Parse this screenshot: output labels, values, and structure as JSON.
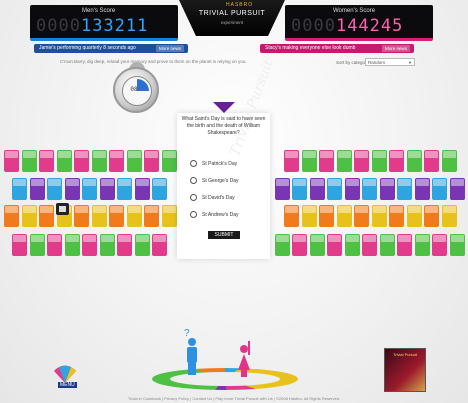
{
  "header": {
    "men_score_label": "Men's Score",
    "men_score_prefix": "0000",
    "men_score_value": "133211",
    "women_score_label": "Women's Score",
    "women_score_prefix": "0000",
    "women_score_value": "144245",
    "logo_mark": "HASBRO",
    "logo_title": "TRIVIAL PURSUIT",
    "logo_subtitle": "experiment"
  },
  "tickers": {
    "men_message": "Jamie's performing quarterly 8 seconds ago",
    "men_button": "More news",
    "women_message": "Stacy's making everyone else look dumb",
    "women_button": "More news"
  },
  "info_text": "C'mon Barry, dig deep, reload your memory and prove to them on the planet is relying on you.",
  "sort": {
    "label": "Sort by category",
    "value": "Random"
  },
  "timer": {
    "value": "08"
  },
  "question": {
    "text": "What Saint's Day is said to have seen the birth and the death of William Shakespeare?",
    "options": [
      "St Patrick's Day",
      "St George's Day",
      "St David's Day",
      "St Andrew's Day"
    ],
    "submit_label": "SUBMIT",
    "watermark": "Trivial Pursuit"
  },
  "menu": {
    "label": "MENU"
  },
  "gamebox": {
    "title": "Trivial Pursuit"
  },
  "footer": "Trivia in Cookbook | Privacy Policy | Contact Us | Play more Trivial Pursuit with Us | ©2008 Hasbro. All Rights Reserved.",
  "colors": {
    "men": "#1f7fd0",
    "women": "#d61f7d",
    "triangle": "#6a1f9a",
    "tiles": [
      "#e23b8c",
      "#e8c21c",
      "#2ea4e0",
      "#4ec043",
      "#f07a1c",
      "#7a35b5"
    ]
  }
}
